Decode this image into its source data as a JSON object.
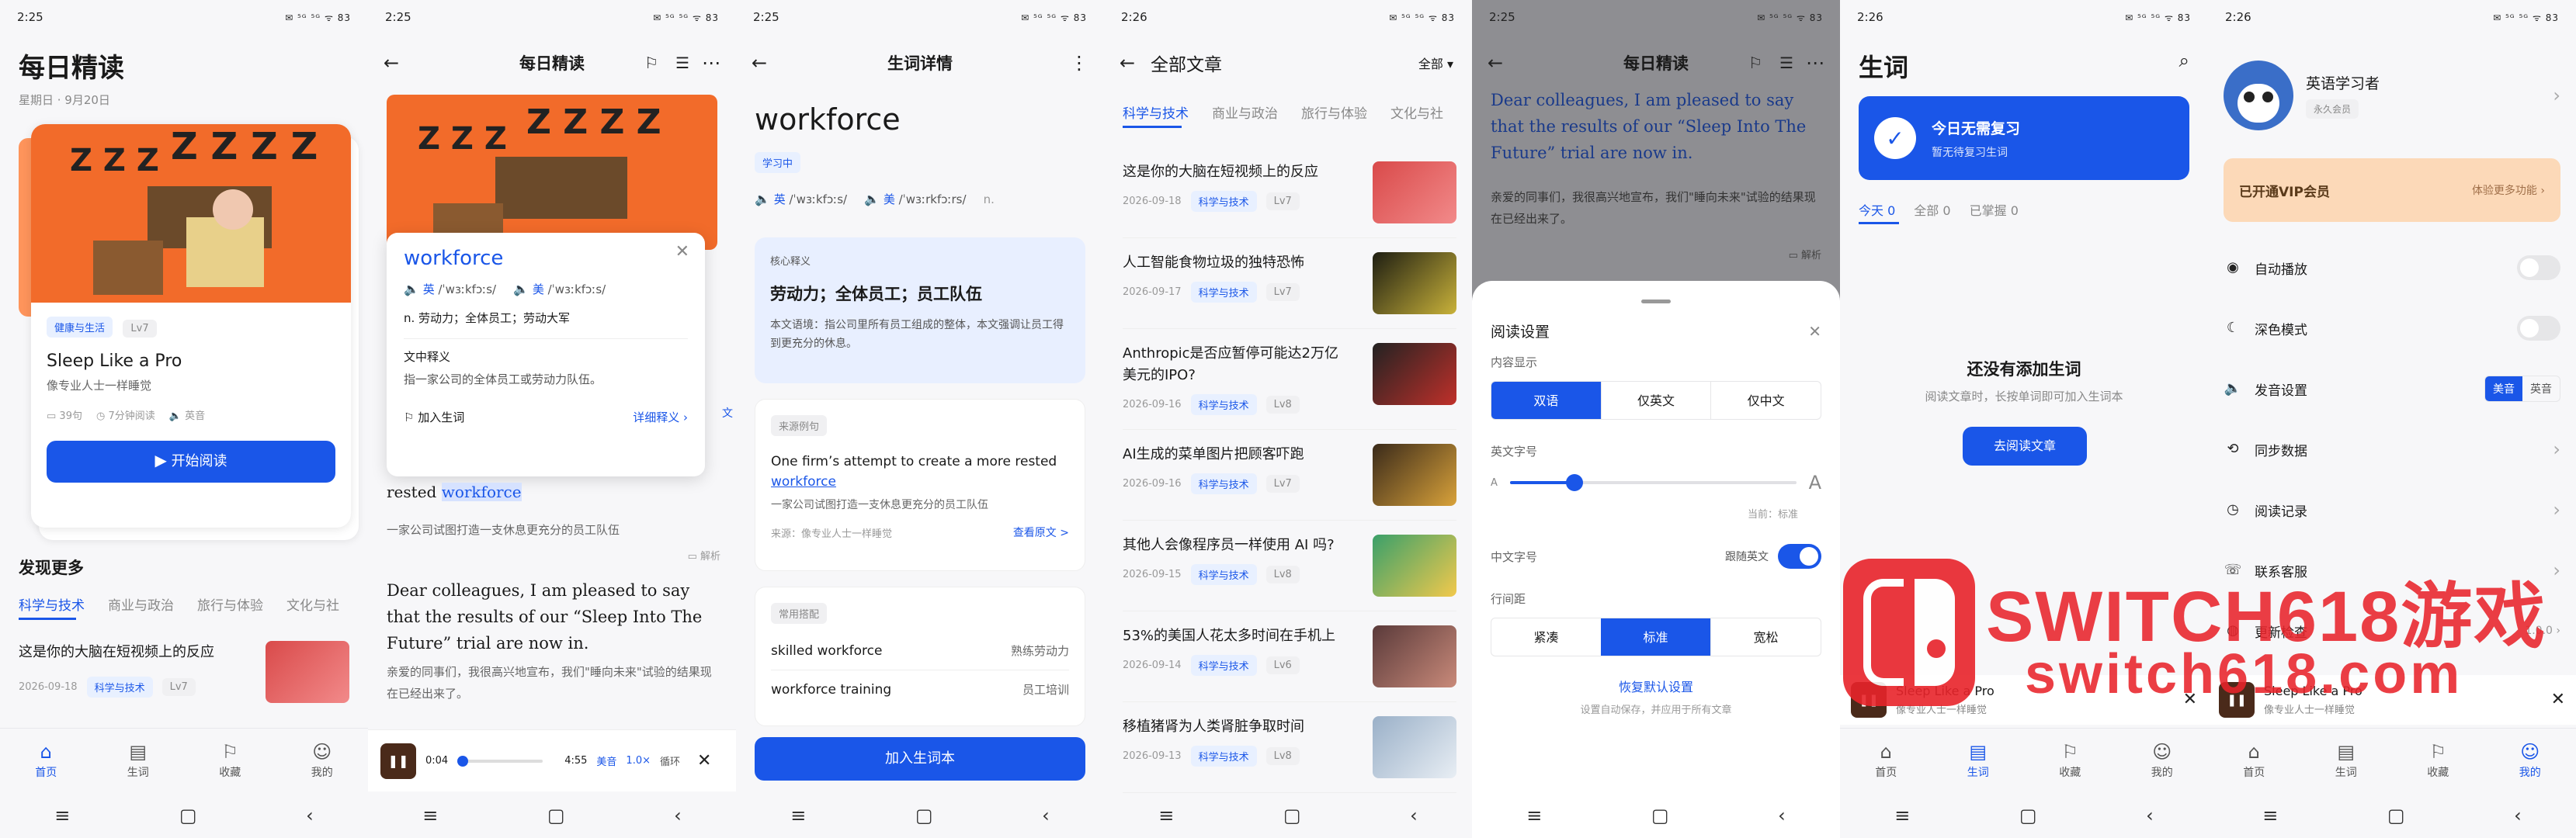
{
  "status": {
    "t1": "2:25",
    "t2": "2:25",
    "t3": "2:25",
    "t4": "2:26",
    "t5": "2:25",
    "t6": "2:26",
    "t7": "2:26",
    "icons": "✉ ⁵ᴳ ⁵ᴳ ᯤ 83"
  },
  "nav": {
    "home": "首页",
    "vocab": "生词",
    "fav": "收藏",
    "me": "我的"
  },
  "s1": {
    "title": "每日精读",
    "date": "星期日 · 9月20日",
    "card": {
      "tag1": "健康与生活",
      "tag2": "Lv7",
      "title": "Sleep Like a Pro",
      "sub": "像专业人士一样睡觉",
      "m1": "39句",
      "m2": "7分钟阅读",
      "m3": "英音",
      "btn": "开始阅读"
    },
    "more": "发现更多",
    "cats": [
      "科学与技术",
      "商业与政治",
      "旅行与体验",
      "文化与社"
    ],
    "art": {
      "title": "这是你的大脑在短视频上的反应",
      "date": "2026-09-18",
      "tag": "科学与技术",
      "lv": "Lv7"
    }
  },
  "s2": {
    "title": "每日精读",
    "popup": {
      "word": "workforce",
      "uk": "英",
      "uk_ph": "/ˈwɜːkfɔːs/",
      "us": "美",
      "us_ph": "/ˈwɜːkfɔːs/",
      "def": "n. 劳动力；全体员工；劳动大军",
      "cn_title": "文中释义",
      "cn_def": "指一家公司的全体员工或劳动力队伍。",
      "add": "加入生词",
      "detail": "详细释义 ›",
      "side": "文"
    },
    "line1": "rested",
    "hl": "workforce",
    "tr1": "一家公司试图打造一支休息更充分的员工队伍",
    "parse": "解析",
    "para": "Dear colleagues, I am pleased to say that the results of our “Sleep Into The Future” trial are now in.",
    "tr2": "亲爱的同事们，我很高兴地宣布，我们\"睡向未来\"试验的结果现在已经出来了。",
    "player": {
      "cur": "0:04",
      "total": "4:55",
      "acc": "美音",
      "speed": "1.0×",
      "loop": "循环"
    }
  },
  "s3": {
    "title": "生词详情",
    "word": "workforce",
    "status": "学习中",
    "uk": "英",
    "uk_ph": "/ˈwɜːkfɔːs/",
    "us": "美",
    "us_ph": "/ˈwɜːrkfɔːrs/",
    "n": "n.",
    "core_label": "核心释义",
    "core": "劳动力；全体员工；员工队伍",
    "core_desc": "本文语境：指公司里所有员工组成的整体，本文强调让员工得到更充分的休息。",
    "ex_label": "来源例句",
    "ex_pre": "One firm’s attempt to create a more rested ",
    "ex_word": "workforce",
    "ex_tr": "一家公司试图打造一支休息更充分的员工队伍",
    "ex_src": "来源：像专业人士一样睡觉",
    "ex_link": "查看原文 >",
    "col_label": "常用搭配",
    "col": [
      {
        "en": "skilled workforce",
        "zh": "熟练劳动力"
      },
      {
        "en": "workforce training",
        "zh": "员工培训"
      }
    ],
    "btn": "加入生词本"
  },
  "s4": {
    "title": "全部文章",
    "filter": "全部",
    "cats": [
      "科学与技术",
      "商业与政治",
      "旅行与体验",
      "文化与社"
    ],
    "arts": [
      {
        "t": "这是你的大脑在短视频上的反应",
        "d": "2026-09-18",
        "tag": "科学与技术",
        "lv": "Lv7",
        "c1": "#d94a4a",
        "c2": "#f28a8a"
      },
      {
        "t": "人工智能食物垃圾的独特恐怖",
        "d": "2026-09-17",
        "tag": "科学与技术",
        "lv": "Lv7",
        "c1": "#1e1e12",
        "c2": "#c9b23a"
      },
      {
        "t": "Anthropic是否应暂停可能达2万亿美元的IPO?",
        "d": "2026-09-16",
        "tag": "科学与技术",
        "lv": "Lv8",
        "c1": "#222",
        "c2": "#c0302a"
      },
      {
        "t": "AI生成的菜单图片把顾客吓跑",
        "d": "2026-09-16",
        "tag": "科学与技术",
        "lv": "Lv7",
        "c1": "#3a2a1a",
        "c2": "#d9a23a"
      },
      {
        "t": "其他人会像程序员一样使用 AI 吗?",
        "d": "2026-09-15",
        "tag": "科学与技术",
        "lv": "Lv8",
        "c1": "#3aa06a",
        "c2": "#f2c94c"
      },
      {
        "t": "53%的美国人花太多时间在手机上",
        "d": "2026-09-14",
        "tag": "科学与技术",
        "lv": "Lv6",
        "c1": "#5a3a3a",
        "c2": "#c98a7a"
      },
      {
        "t": "移植猪肾为人类肾脏争取时间",
        "d": "2026-09-13",
        "tag": "科学与技术",
        "lv": "Lv8",
        "c1": "#9ab0c8",
        "c2": "#e8eef4"
      }
    ]
  },
  "s5": {
    "title": "每日精读",
    "para": "Dear colleagues, I am pleased to say that the results of our “Sleep Into The Future” trial are now in.",
    "tr": "亲爱的同事们，我很高兴地宣布，我们\"睡向未来\"试验的结果现在已经出来了。",
    "parse": "解析",
    "sheet": {
      "title": "阅读设置",
      "content_label": "内容显示",
      "content_opts": [
        "双语",
        "仅英文",
        "仅中文"
      ],
      "en_size": "英文字号",
      "a_small": "A",
      "a_big": "A",
      "current": "当前：标准",
      "cn_size": "中文字号",
      "follow": "跟随英文",
      "spacing": "行间距",
      "sp_opts": [
        "紧凑",
        "标准",
        "宽松"
      ],
      "reset": "恢复默认设置",
      "note": "设置自动保存，并应用于所有文章"
    }
  },
  "s6": {
    "title": "生词",
    "banner_title": "今日无需复习",
    "banner_sub": "暂无待复习生词",
    "tabs": [
      {
        "l": "今天",
        "n": "0"
      },
      {
        "l": "全部",
        "n": "0"
      },
      {
        "l": "已掌握",
        "n": "0"
      }
    ],
    "empty_title": "还没有添加生词",
    "empty_sub": "阅读文章时，长按单词即可加入生词本",
    "btn": "去阅读文章",
    "mini_title": "Sleep Like a Pro",
    "mini_sub": "像专业人士一样睡觉"
  },
  "s7": {
    "name": "英语学习者",
    "badge": "永久会员",
    "vip": "已开通VIP会员",
    "vip_more": "体验更多功能 ›",
    "items": [
      {
        "ic": "◉",
        "l": "自动播放",
        "type": "switch"
      },
      {
        "ic": "☾",
        "l": "深色模式",
        "type": "switch"
      },
      {
        "ic": "🔈",
        "l": "发音设置",
        "type": "seg"
      },
      {
        "ic": "⟲",
        "l": "同步数据",
        "type": "arrow"
      },
      {
        "ic": "◷",
        "l": "阅读记录",
        "type": "arrow"
      },
      {
        "ic": "☏",
        "l": "联系客服",
        "type": "arrow"
      },
      {
        "ic": "◍",
        "l": "更新检查",
        "type": "arrow"
      }
    ],
    "ver": "1.0.0",
    "acc": [
      "美音",
      "英音"
    ],
    "mini_title": "Sleep Like a Pro",
    "mini_sub": "像专业人士一样睡觉"
  },
  "wm": {
    "big": "SWITCH618游戏",
    "small": "switch618.com"
  },
  "colors": {
    "accent": "#1a56e8",
    "orange": "#f26b2a",
    "vip": "#fcd9b8"
  }
}
